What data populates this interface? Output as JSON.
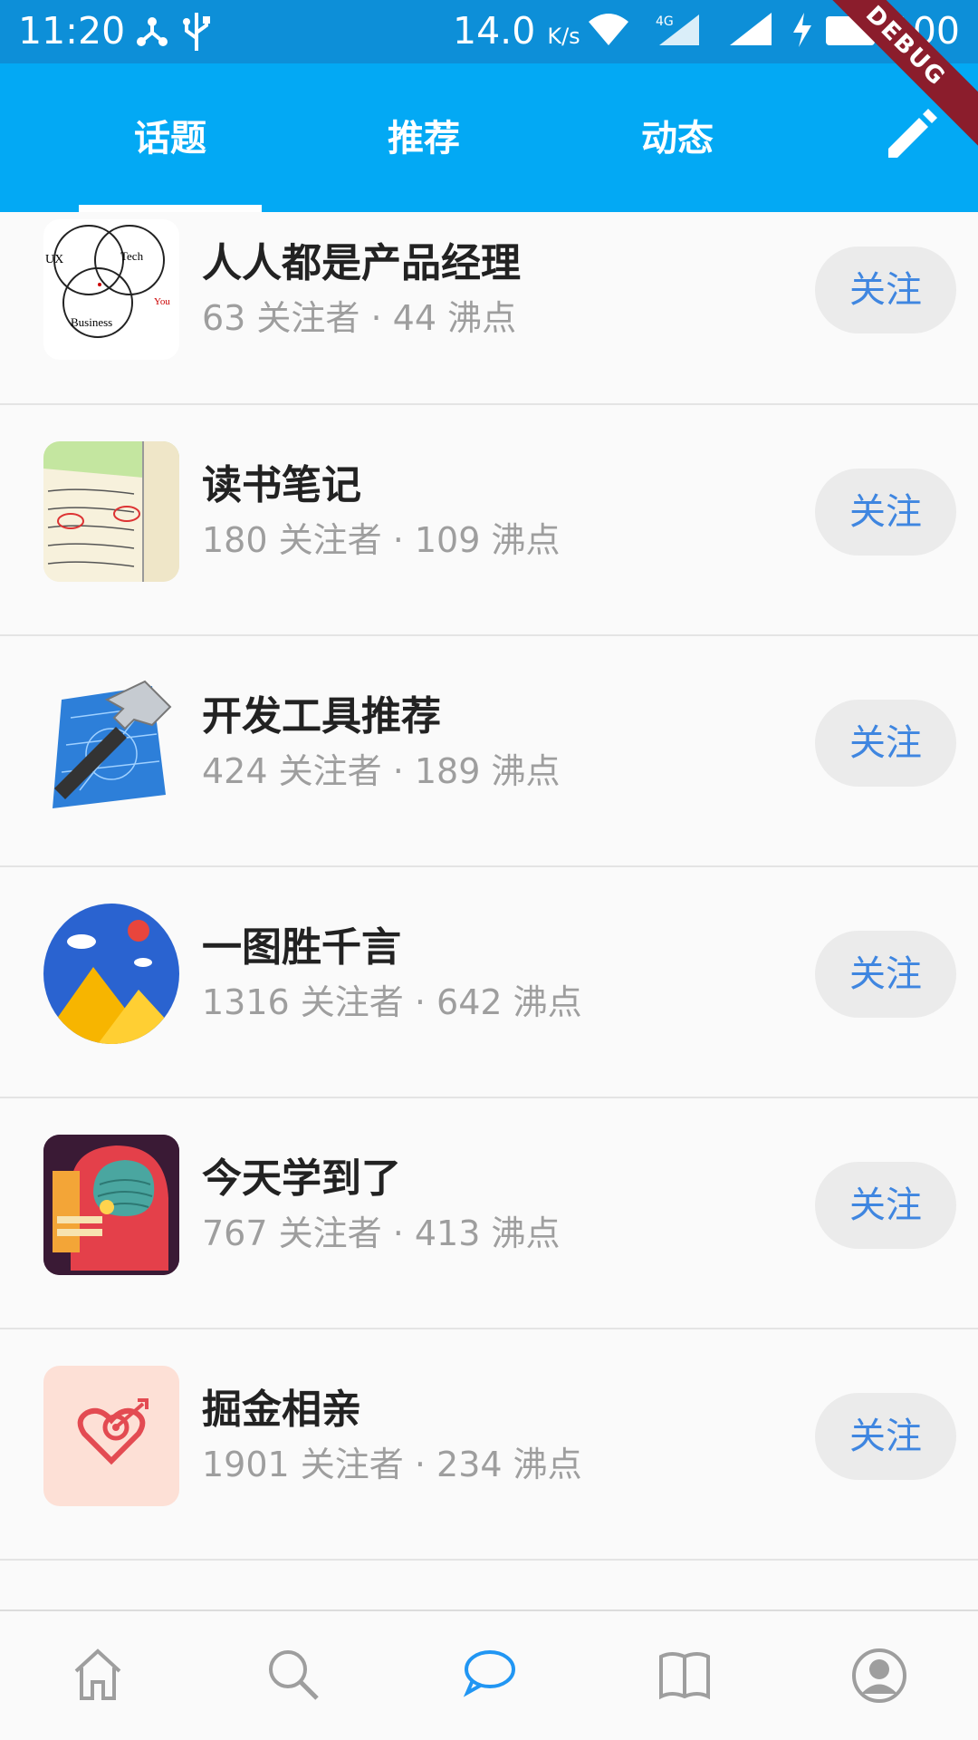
{
  "status_bar": {
    "time": "11:20",
    "speed": "14.0",
    "speed_unit": "K/s",
    "network": "4G",
    "battery": "100"
  },
  "debug_label": "DEBUG",
  "tabs": [
    {
      "label": "话题",
      "active": true
    },
    {
      "label": "推荐",
      "active": false
    },
    {
      "label": "动态",
      "active": false
    }
  ],
  "topics": [
    {
      "title": "人人都是产品经理",
      "meta": "63 关注者 · 44 沸点",
      "button": "关注",
      "icon": "venn-diagram-icon"
    },
    {
      "title": "读书笔记",
      "meta": "180 关注者 · 109 沸点",
      "button": "关注",
      "icon": "notebook-icon"
    },
    {
      "title": "开发工具推荐",
      "meta": "424 关注者 · 189 沸点",
      "button": "关注",
      "icon": "hammer-blueprint-icon"
    },
    {
      "title": "一图胜千言",
      "meta": "1316 关注者 · 642 沸点",
      "button": "关注",
      "icon": "landscape-picture-icon"
    },
    {
      "title": "今天学到了",
      "meta": "767 关注者 · 413 沸点",
      "button": "关注",
      "icon": "brain-head-icon"
    },
    {
      "title": "掘金相亲",
      "meta": "1901 关注者 · 234 沸点",
      "button": "关注",
      "icon": "heart-target-icon"
    }
  ],
  "bottom_nav": [
    {
      "icon": "home-icon",
      "active": false
    },
    {
      "icon": "search-icon",
      "active": false
    },
    {
      "icon": "chat-bubble-icon",
      "active": true
    },
    {
      "icon": "book-icon",
      "active": false
    },
    {
      "icon": "profile-icon",
      "active": false
    }
  ],
  "colors": {
    "app_bar": "#03a9f4",
    "status_bar": "#0d8fd8",
    "follow_text": "#3f86e0",
    "active_nav": "#2196f3",
    "inactive_nav": "#9e9e9e"
  }
}
